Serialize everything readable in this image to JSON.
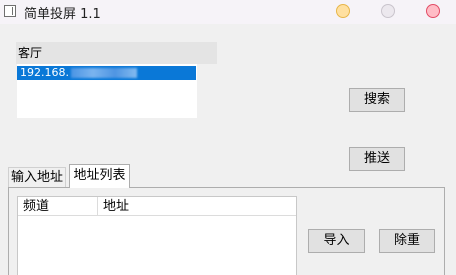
{
  "window": {
    "title": "简单投屏 1.1",
    "app_icon": "window-app-icon"
  },
  "window_controls": {
    "minimize_color": "#ffe0a0",
    "maximize_color": "#ece8ee",
    "close_color": "#ffbcc6"
  },
  "devices": {
    "header": "客厅",
    "items": [
      {
        "label": "192.168.",
        "redacted": true
      }
    ],
    "selection_color": "#0a78d7"
  },
  "buttons": {
    "search": "搜索",
    "push": "推送",
    "import": "导入",
    "dedup": "除重"
  },
  "tabs": [
    {
      "label": "输入地址",
      "active": false
    },
    {
      "label": "地址列表",
      "active": true
    }
  ],
  "address_table": {
    "columns": [
      "频道",
      "地址"
    ],
    "rows": []
  }
}
